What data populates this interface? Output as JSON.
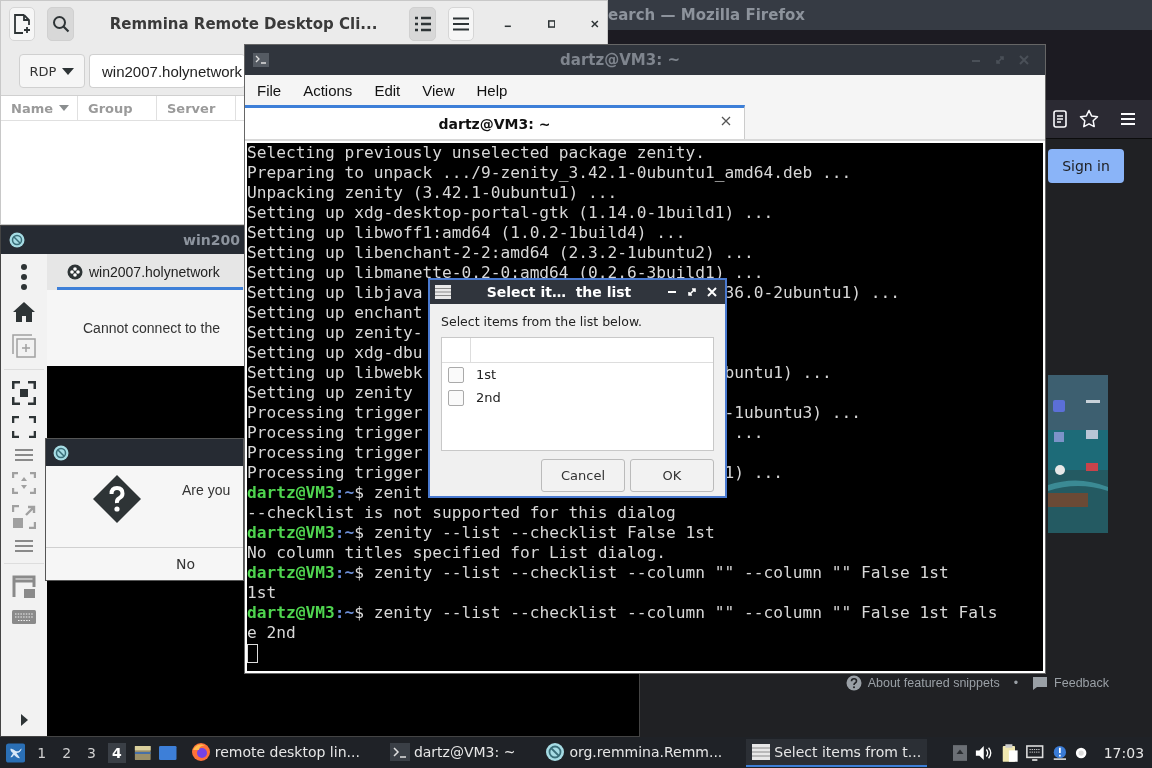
{
  "firefox_window": {
    "title": "earch — Mozilla Firefox",
    "sign_in": "Sign in",
    "footer": {
      "about": "About featured snippets",
      "separator": "•",
      "feedback": "Feedback"
    }
  },
  "remmina_main": {
    "title": "Remmina Remote Desktop Cli...",
    "list_view_on": true,
    "protocol": "RDP",
    "address": "win2007.holynetwork",
    "columns": [
      {
        "label": "Name",
        "sorted": true
      },
      {
        "label": "Group",
        "sorted": false
      },
      {
        "label": "Server",
        "sorted": false
      }
    ]
  },
  "remmina_connection": {
    "title": "win200",
    "tab": "win2007.holynetwork",
    "message": "Cannot connect to the",
    "confirm_dialog": {
      "message": "Are you",
      "button": "No"
    }
  },
  "terminal": {
    "title": "dartz@VM3: ~",
    "menu": [
      "File",
      "Actions",
      "Edit",
      "View",
      "Help"
    ],
    "tab": "dartz@VM3: ~",
    "lines": [
      {
        "kind": "output",
        "text": "Selecting previously unselected package zenity."
      },
      {
        "kind": "output",
        "text": "Preparing to unpack .../9-zenity_3.42.1-0ubuntu1_amd64.deb ..."
      },
      {
        "kind": "output",
        "text": "Unpacking zenity (3.42.1-0ubuntu1) ..."
      },
      {
        "kind": "output",
        "text": "Setting up xdg-desktop-portal-gtk (1.14.0-1build1) ..."
      },
      {
        "kind": "output",
        "text": "Setting up libwoff1:amd64 (1.0.2-1build4) ..."
      },
      {
        "kind": "output",
        "text": "Setting up libenchant-2-2:amd64 (2.3.2-1ubuntu2) ..."
      },
      {
        "kind": "output",
        "text": "Setting up libmanette-0.2-0:amd64 (0.2.6-3build1) ..."
      },
      {
        "kind": "output",
        "text": "Setting up libjava",
        "tail": "36.0-2ubuntu1) ..."
      },
      {
        "kind": "output",
        "text": "Setting up enchant"
      },
      {
        "kind": "output",
        "text": "Setting up zenity-"
      },
      {
        "kind": "output",
        "text": "Setting up xdg-dbu"
      },
      {
        "kind": "output",
        "text": "Setting up libwebk",
        "tail": "buntu1) ..."
      },
      {
        "kind": "output",
        "text": "Setting up zenity"
      },
      {
        "kind": "output",
        "text": "Processing trigger",
        "tail": "-1ubuntu3) ..."
      },
      {
        "kind": "output",
        "text": "Processing trigger",
        "tail": " ..."
      },
      {
        "kind": "output",
        "text": "Processing trigger"
      },
      {
        "kind": "output",
        "text": "Processing trigger",
        "tail": "1) ..."
      },
      {
        "kind": "prompt",
        "user": "dartz@VM3",
        "path": ":~",
        "text": "$ zenit"
      },
      {
        "kind": "output",
        "text": "--checklist is not supported for this dialog"
      },
      {
        "kind": "prompt",
        "user": "dartz@VM3",
        "path": ":~",
        "text": "$ zenity --list --checklist False 1st"
      },
      {
        "kind": "output",
        "text": "No column titles specified for List dialog."
      },
      {
        "kind": "prompt",
        "user": "dartz@VM3",
        "path": ":~",
        "text": "$ zenity --list --checklist --column \"\" --column \"\" False 1st"
      },
      {
        "kind": "output",
        "text": "1st"
      },
      {
        "kind": "prompt",
        "user": "dartz@VM3",
        "path": ":~",
        "text": "$ zenity --list --checklist --column \"\" --column \"\" False 1st Fals"
      },
      {
        "kind": "output",
        "text": "e 2nd"
      }
    ]
  },
  "list_dialog": {
    "title": "Select it…  the list",
    "prompt": "Select items from the list below.",
    "items": [
      {
        "label": "1st",
        "checked": false
      },
      {
        "label": "2nd",
        "checked": false
      }
    ],
    "buttons": [
      "Cancel",
      "OK"
    ]
  },
  "taskbar": {
    "workspaces": [
      {
        "label": "1",
        "selected": false
      },
      {
        "label": "2",
        "selected": false
      },
      {
        "label": "3",
        "selected": false
      },
      {
        "label": "4",
        "selected": true
      }
    ],
    "tasks": [
      {
        "kind": "firefox",
        "label": "remote desktop lin...",
        "selected": false
      },
      {
        "kind": "terminal",
        "label": "dartz@VM3: ~",
        "selected": false
      },
      {
        "kind": "remmina",
        "label": "org.remmina.Remm...",
        "selected": false
      },
      {
        "kind": "list",
        "label": "Select items from t...",
        "selected": true
      }
    ],
    "clock": "17:03"
  }
}
